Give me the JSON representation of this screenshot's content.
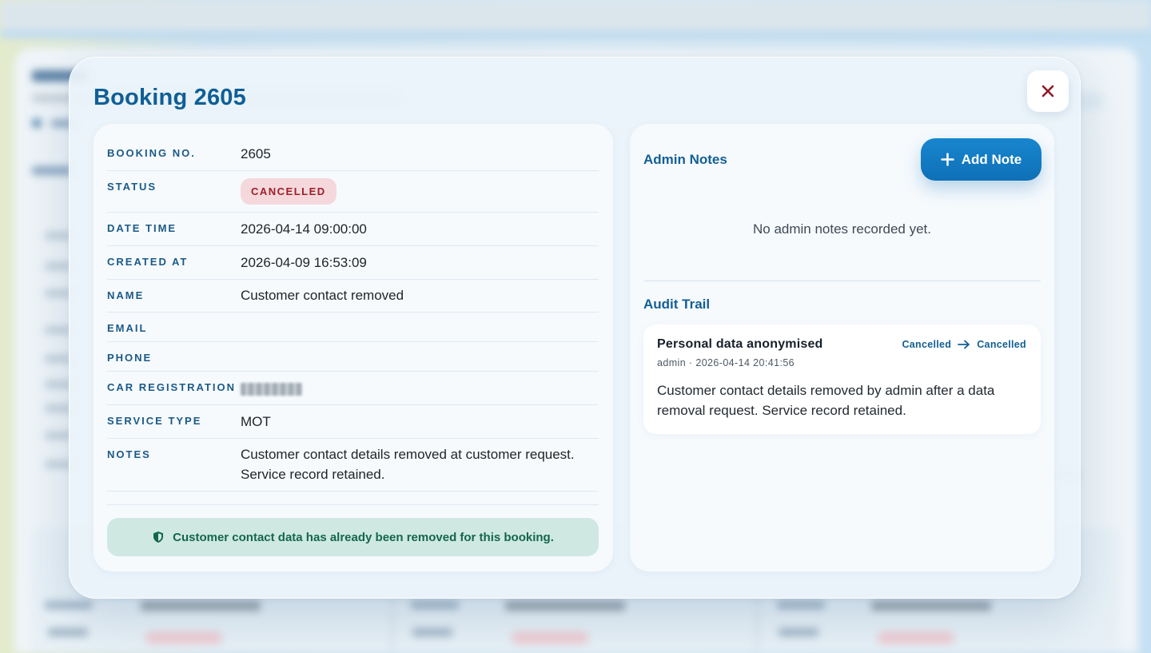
{
  "modal": {
    "title": "Booking 2605"
  },
  "details": [
    {
      "label": "BOOKING NO.",
      "value": "2605"
    },
    {
      "label": "STATUS",
      "value": "CANCELLED"
    },
    {
      "label": "DATE TIME",
      "value": "2026-04-14 09:00:00"
    },
    {
      "label": "CREATED AT",
      "value": "2026-04-09 16:53:09"
    },
    {
      "label": "NAME",
      "value": "Customer contact removed"
    },
    {
      "label": "EMAIL",
      "value": ""
    },
    {
      "label": "PHONE",
      "value": ""
    },
    {
      "label": "CAR REGISTRATION",
      "value": ""
    },
    {
      "label": "SERVICE TYPE",
      "value": "MOT"
    },
    {
      "label": "NOTES",
      "value": "Customer contact details removed at customer request. Service record retained."
    }
  ],
  "notice": "Customer contact data has already been removed for this booking.",
  "admin_notes": {
    "title": "Admin Notes",
    "add_label": "Add Note",
    "empty": "No admin notes recorded yet."
  },
  "audit": {
    "title": "Audit Trail",
    "entries": [
      {
        "title": "Personal data anonymised",
        "meta": "admin · 2026-04-14 20:41:56",
        "from": "Cancelled",
        "to": "Cancelled",
        "body": "Customer contact details removed by admin after a data removal request. Service record retained."
      }
    ]
  },
  "colors": {
    "accent": "#0f5f96",
    "button": "#1786cf",
    "status_cancelled_bg": "#f5d8dc",
    "status_cancelled_text": "#9d1f2a",
    "notice_bg": "#cfe9e2",
    "notice_text": "#14664d"
  },
  "icons": {
    "close": "close-icon",
    "add": "plus-icon",
    "notice": "shield-icon",
    "transition": "arrow-right-icon"
  }
}
